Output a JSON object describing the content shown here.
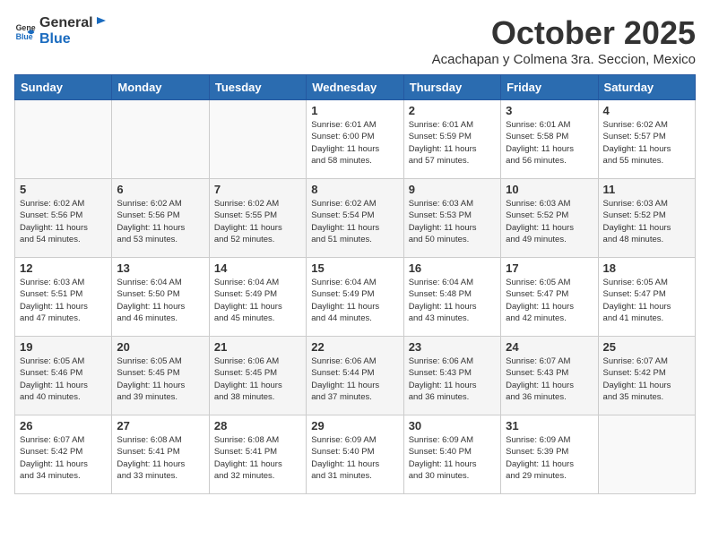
{
  "header": {
    "logo_general": "General",
    "logo_blue": "Blue",
    "month_title": "October 2025",
    "location": "Acachapan y Colmena 3ra. Seccion, Mexico"
  },
  "weekdays": [
    "Sunday",
    "Monday",
    "Tuesday",
    "Wednesday",
    "Thursday",
    "Friday",
    "Saturday"
  ],
  "weeks": [
    [
      {
        "day": "",
        "info": ""
      },
      {
        "day": "",
        "info": ""
      },
      {
        "day": "",
        "info": ""
      },
      {
        "day": "1",
        "info": "Sunrise: 6:01 AM\nSunset: 6:00 PM\nDaylight: 11 hours\nand 58 minutes."
      },
      {
        "day": "2",
        "info": "Sunrise: 6:01 AM\nSunset: 5:59 PM\nDaylight: 11 hours\nand 57 minutes."
      },
      {
        "day": "3",
        "info": "Sunrise: 6:01 AM\nSunset: 5:58 PM\nDaylight: 11 hours\nand 56 minutes."
      },
      {
        "day": "4",
        "info": "Sunrise: 6:02 AM\nSunset: 5:57 PM\nDaylight: 11 hours\nand 55 minutes."
      }
    ],
    [
      {
        "day": "5",
        "info": "Sunrise: 6:02 AM\nSunset: 5:56 PM\nDaylight: 11 hours\nand 54 minutes."
      },
      {
        "day": "6",
        "info": "Sunrise: 6:02 AM\nSunset: 5:56 PM\nDaylight: 11 hours\nand 53 minutes."
      },
      {
        "day": "7",
        "info": "Sunrise: 6:02 AM\nSunset: 5:55 PM\nDaylight: 11 hours\nand 52 minutes."
      },
      {
        "day": "8",
        "info": "Sunrise: 6:02 AM\nSunset: 5:54 PM\nDaylight: 11 hours\nand 51 minutes."
      },
      {
        "day": "9",
        "info": "Sunrise: 6:03 AM\nSunset: 5:53 PM\nDaylight: 11 hours\nand 50 minutes."
      },
      {
        "day": "10",
        "info": "Sunrise: 6:03 AM\nSunset: 5:52 PM\nDaylight: 11 hours\nand 49 minutes."
      },
      {
        "day": "11",
        "info": "Sunrise: 6:03 AM\nSunset: 5:52 PM\nDaylight: 11 hours\nand 48 minutes."
      }
    ],
    [
      {
        "day": "12",
        "info": "Sunrise: 6:03 AM\nSunset: 5:51 PM\nDaylight: 11 hours\nand 47 minutes."
      },
      {
        "day": "13",
        "info": "Sunrise: 6:04 AM\nSunset: 5:50 PM\nDaylight: 11 hours\nand 46 minutes."
      },
      {
        "day": "14",
        "info": "Sunrise: 6:04 AM\nSunset: 5:49 PM\nDaylight: 11 hours\nand 45 minutes."
      },
      {
        "day": "15",
        "info": "Sunrise: 6:04 AM\nSunset: 5:49 PM\nDaylight: 11 hours\nand 44 minutes."
      },
      {
        "day": "16",
        "info": "Sunrise: 6:04 AM\nSunset: 5:48 PM\nDaylight: 11 hours\nand 43 minutes."
      },
      {
        "day": "17",
        "info": "Sunrise: 6:05 AM\nSunset: 5:47 PM\nDaylight: 11 hours\nand 42 minutes."
      },
      {
        "day": "18",
        "info": "Sunrise: 6:05 AM\nSunset: 5:47 PM\nDaylight: 11 hours\nand 41 minutes."
      }
    ],
    [
      {
        "day": "19",
        "info": "Sunrise: 6:05 AM\nSunset: 5:46 PM\nDaylight: 11 hours\nand 40 minutes."
      },
      {
        "day": "20",
        "info": "Sunrise: 6:05 AM\nSunset: 5:45 PM\nDaylight: 11 hours\nand 39 minutes."
      },
      {
        "day": "21",
        "info": "Sunrise: 6:06 AM\nSunset: 5:45 PM\nDaylight: 11 hours\nand 38 minutes."
      },
      {
        "day": "22",
        "info": "Sunrise: 6:06 AM\nSunset: 5:44 PM\nDaylight: 11 hours\nand 37 minutes."
      },
      {
        "day": "23",
        "info": "Sunrise: 6:06 AM\nSunset: 5:43 PM\nDaylight: 11 hours\nand 36 minutes."
      },
      {
        "day": "24",
        "info": "Sunrise: 6:07 AM\nSunset: 5:43 PM\nDaylight: 11 hours\nand 36 minutes."
      },
      {
        "day": "25",
        "info": "Sunrise: 6:07 AM\nSunset: 5:42 PM\nDaylight: 11 hours\nand 35 minutes."
      }
    ],
    [
      {
        "day": "26",
        "info": "Sunrise: 6:07 AM\nSunset: 5:42 PM\nDaylight: 11 hours\nand 34 minutes."
      },
      {
        "day": "27",
        "info": "Sunrise: 6:08 AM\nSunset: 5:41 PM\nDaylight: 11 hours\nand 33 minutes."
      },
      {
        "day": "28",
        "info": "Sunrise: 6:08 AM\nSunset: 5:41 PM\nDaylight: 11 hours\nand 32 minutes."
      },
      {
        "day": "29",
        "info": "Sunrise: 6:09 AM\nSunset: 5:40 PM\nDaylight: 11 hours\nand 31 minutes."
      },
      {
        "day": "30",
        "info": "Sunrise: 6:09 AM\nSunset: 5:40 PM\nDaylight: 11 hours\nand 30 minutes."
      },
      {
        "day": "31",
        "info": "Sunrise: 6:09 AM\nSunset: 5:39 PM\nDaylight: 11 hours\nand 29 minutes."
      },
      {
        "day": "",
        "info": ""
      }
    ]
  ]
}
